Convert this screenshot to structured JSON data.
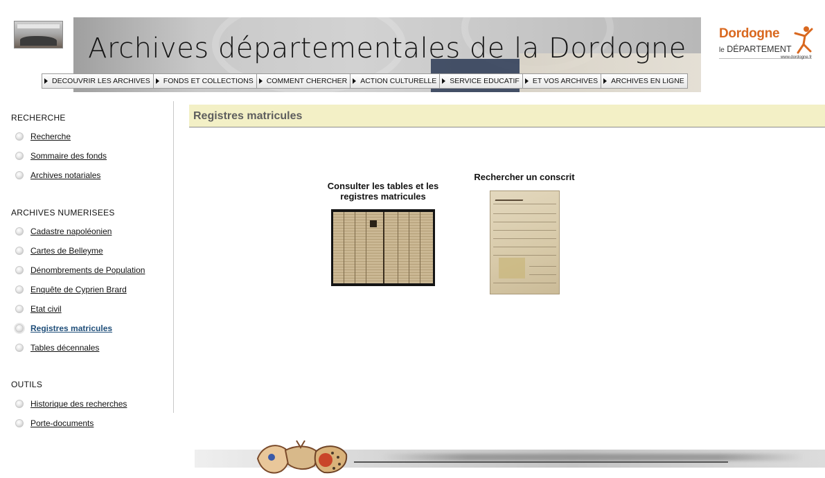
{
  "header": {
    "banner_title": "Archives départementales de la Dordogne",
    "nav": [
      {
        "label": "DECOUVRIR LES ARCHIVES"
      },
      {
        "label": "FONDS ET COLLECTIONS"
      },
      {
        "label": "COMMENT CHERCHER"
      },
      {
        "label": "ACTION CULTURELLE"
      },
      {
        "label": "SERVICE EDUCATIF"
      },
      {
        "label": "ET VOS ARCHIVES"
      },
      {
        "label": "ARCHIVES EN LIGNE"
      }
    ],
    "logo": {
      "name": "Dordogne",
      "sub_prefix": "le",
      "sub": "DÉPARTEMENT",
      "url": "www.dordogne.fr",
      "color": "#d9681f"
    }
  },
  "sidebar": {
    "sections": [
      {
        "title": "RECHERCHE",
        "items": [
          {
            "label": "Recherche"
          },
          {
            "label": "Sommaire des fonds"
          },
          {
            "label": "Archives notariales"
          }
        ]
      },
      {
        "title": "ARCHIVES NUMERISEES",
        "items": [
          {
            "label": "Cadastre napoléonien"
          },
          {
            "label": "Cartes de Belleyme"
          },
          {
            "label": "Dénombrements de Population"
          },
          {
            "label": "Enquête de Cyprien Brard"
          },
          {
            "label": "Etat civil"
          },
          {
            "label": "Registres matricules",
            "active": true
          },
          {
            "label": "Tables décennales"
          }
        ]
      },
      {
        "title": "OUTILS",
        "items": [
          {
            "label": "Historique des recherches"
          },
          {
            "label": "Porte-documents"
          }
        ]
      }
    ]
  },
  "main": {
    "page_title": "Registres matricules",
    "cards": [
      {
        "label_line1": "Consulter les tables et les",
        "label_line2": "registres matricules",
        "image": "register-book-image"
      },
      {
        "label_line1": "Rechercher un conscrit",
        "image": "conscript-record-image"
      }
    ]
  },
  "colors": {
    "page_header_bg": "#f3f0c6",
    "active_link": "#1f4e79"
  }
}
